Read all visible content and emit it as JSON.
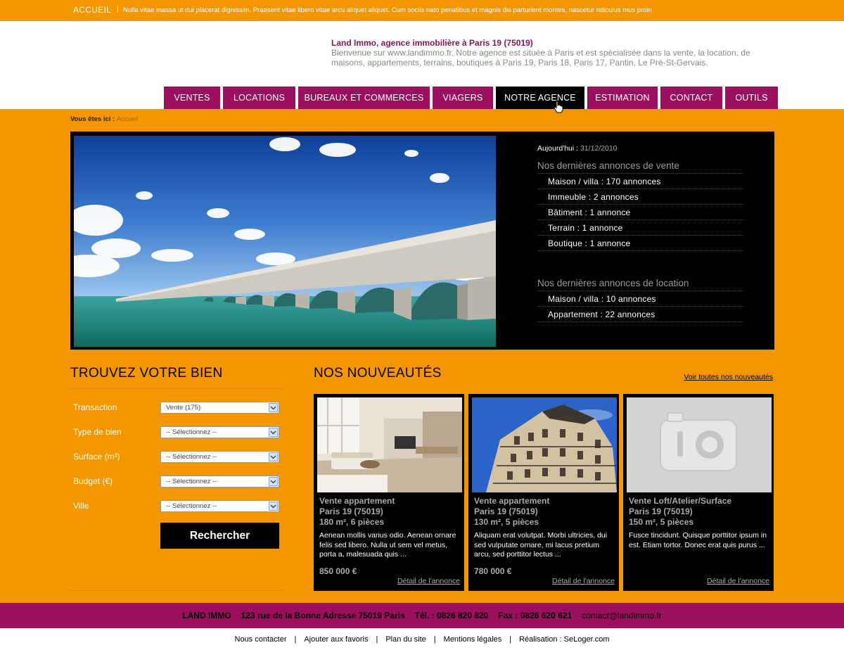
{
  "topbar": {
    "home": "ACCUEIL",
    "separator": "|",
    "tagline": "Nulla vitae massa ut dui placerat dignissim. Praesent vitae libero vitae arcu aliquet aliquet. Cum sociis nato penatibus et magnis dis parturient montes, nascetur ridiculus mus proin"
  },
  "header": {
    "title": "Land Immo, agence immobilière à Paris 19 (75019)",
    "description": "Bienvenue sur www.landimmo.fr. Notre agence est située à Paris et est spécialisée dans la vente, la location, de maisons, appartements, terrains, boutiques à Paris 19, Paris 18, Paris 17, Pantin, Le Pré-St-Gervais."
  },
  "nav": {
    "items": [
      {
        "label": "VENTES"
      },
      {
        "label": "LOCATIONS"
      },
      {
        "label": "BUREAUX ET COMMERCES"
      },
      {
        "label": "VIAGERS"
      },
      {
        "label": "NOTRE AGENCE"
      },
      {
        "label": "ESTIMATION"
      },
      {
        "label": "CONTACT"
      },
      {
        "label": "OUTILS"
      }
    ],
    "active": "NOTRE AGENCE"
  },
  "breadcrumb": {
    "prefix": "Vous êtes ici",
    "separator": " : ",
    "current": "Accueil"
  },
  "hero": {
    "date_label": "Aujourd'hui : ",
    "date_value": "31/12/2010",
    "sale": {
      "title": "Nos dernières annonces de vente",
      "items": [
        "Maison / villa : 170 annonces",
        "Immeuble : 2 annonces",
        "Bâtiment : 1 annonce",
        "Terrain : 1 annonce",
        "Boutique : 1 annonce"
      ]
    },
    "rent": {
      "title": "Nos dernières annonces de location",
      "items": [
        "Maison / villa : 10 annonces",
        "Appartement : 22 annonces"
      ]
    }
  },
  "search": {
    "title": "TROUVEZ VOTRE BIEN",
    "fields": [
      {
        "label": "Transaction",
        "value": "Vente (175)"
      },
      {
        "label": "Type de bien",
        "value": "-- Sélectionnez --"
      },
      {
        "label": "Surface (m²)",
        "value": "-- Sélectionnez --"
      },
      {
        "label": "Budget (€)",
        "value": "-- Sélectionnez --"
      },
      {
        "label": "Ville",
        "value": "-- Sélectionnez --"
      }
    ],
    "button": "Rechercher"
  },
  "news": {
    "title": "NOS NOUVEAUTÉS",
    "all_link": "Voir toutes nos nouveautés",
    "cards": [
      {
        "type": "Vente appartement",
        "city": "Paris 19 (75019)",
        "specs": "180 m², 6 pièces",
        "desc": "Aenean mollis varius odio. Aenean ornare felis sed libero. Nulla ut sem vel metus, porta a, malesuada quis ...",
        "price": "850 000 €",
        "link": "Détail de l'annonce"
      },
      {
        "type": "Vente appartement",
        "city": "Paris 19 (75019)",
        "specs": "130 m², 5 pièces",
        "desc": "Aliquam erat volutpat. Morbi ultricies, dui sed vulputate ornare, mi lacus pretium arcu, sed porttitor lectus ...",
        "price": "780 000 €",
        "link": "Détail de l'annonce"
      },
      {
        "type": "Vente Loft/Atelier/Surface",
        "city": "Paris 19 (75019)",
        "specs": "150 m², 5 pièces",
        "desc": "Fusce tincidunt. Quisque porttitor ipsum in est. Etiam tortor. Donec erat quis purus ...",
        "price": "",
        "link": "Détail de l'annonce"
      }
    ]
  },
  "footer": {
    "name": "LAND IMMO",
    "address": "123 rue de la Bonne Adresse 75019 Paris",
    "tel": "Tél. : 0826 820 820",
    "fax": "Fax : 0826 620 621",
    "email": "contact@landimmo.fr"
  },
  "bottom_links": [
    "Nous contacter",
    "Ajouter aux favoris",
    "Plan du site",
    "Mentions légales",
    "Réalisation : SeLoger.com"
  ],
  "colors": {
    "orange": "#f39600",
    "magenta": "#9c0f5f",
    "black": "#000000"
  }
}
